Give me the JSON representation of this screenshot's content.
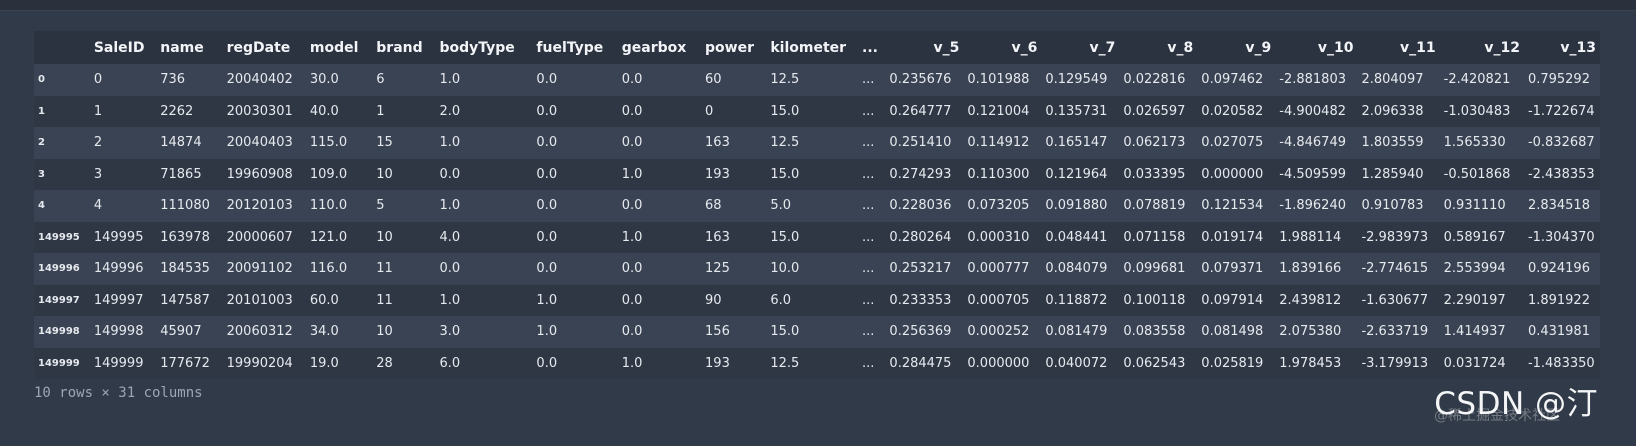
{
  "table": {
    "columns": [
      "",
      "SaleID",
      "name",
      "regDate",
      "model",
      "brand",
      "bodyType",
      "fuelType",
      "gearbox",
      "power",
      "kilometer",
      "...",
      "v_5",
      "v_6",
      "v_7",
      "v_8",
      "v_9",
      "v_10",
      "v_11",
      "v_12",
      "v_13"
    ],
    "rows": [
      [
        "0",
        "0",
        "736",
        "20040402",
        "30.0",
        "6",
        "1.0",
        "0.0",
        "0.0",
        "60",
        "12.5",
        "...",
        "0.235676",
        "0.101988",
        "0.129549",
        "0.022816",
        "0.097462",
        "-2.881803",
        "2.804097",
        "-2.420821",
        "0.795292"
      ],
      [
        "1",
        "1",
        "2262",
        "20030301",
        "40.0",
        "1",
        "2.0",
        "0.0",
        "0.0",
        "0",
        "15.0",
        "...",
        "0.264777",
        "0.121004",
        "0.135731",
        "0.026597",
        "0.020582",
        "-4.900482",
        "2.096338",
        "-1.030483",
        "-1.722674"
      ],
      [
        "2",
        "2",
        "14874",
        "20040403",
        "115.0",
        "15",
        "1.0",
        "0.0",
        "0.0",
        "163",
        "12.5",
        "...",
        "0.251410",
        "0.114912",
        "0.165147",
        "0.062173",
        "0.027075",
        "-4.846749",
        "1.803559",
        "1.565330",
        "-0.832687"
      ],
      [
        "3",
        "3",
        "71865",
        "19960908",
        "109.0",
        "10",
        "0.0",
        "0.0",
        "1.0",
        "193",
        "15.0",
        "...",
        "0.274293",
        "0.110300",
        "0.121964",
        "0.033395",
        "0.000000",
        "-4.509599",
        "1.285940",
        "-0.501868",
        "-2.438353"
      ],
      [
        "4",
        "4",
        "111080",
        "20120103",
        "110.0",
        "5",
        "1.0",
        "0.0",
        "0.0",
        "68",
        "5.0",
        "...",
        "0.228036",
        "0.073205",
        "0.091880",
        "0.078819",
        "0.121534",
        "-1.896240",
        "0.910783",
        "0.931110",
        "2.834518"
      ],
      [
        "149995",
        "149995",
        "163978",
        "20000607",
        "121.0",
        "10",
        "4.0",
        "0.0",
        "1.0",
        "163",
        "15.0",
        "...",
        "0.280264",
        "0.000310",
        "0.048441",
        "0.071158",
        "0.019174",
        "1.988114",
        "-2.983973",
        "0.589167",
        "-1.304370"
      ],
      [
        "149996",
        "149996",
        "184535",
        "20091102",
        "116.0",
        "11",
        "0.0",
        "0.0",
        "0.0",
        "125",
        "10.0",
        "...",
        "0.253217",
        "0.000777",
        "0.084079",
        "0.099681",
        "0.079371",
        "1.839166",
        "-2.774615",
        "2.553994",
        "0.924196"
      ],
      [
        "149997",
        "149997",
        "147587",
        "20101003",
        "60.0",
        "11",
        "1.0",
        "1.0",
        "0.0",
        "90",
        "6.0",
        "...",
        "0.233353",
        "0.000705",
        "0.118872",
        "0.100118",
        "0.097914",
        "2.439812",
        "-1.630677",
        "2.290197",
        "1.891922"
      ],
      [
        "149998",
        "149998",
        "45907",
        "20060312",
        "34.0",
        "10",
        "3.0",
        "1.0",
        "0.0",
        "156",
        "15.0",
        "...",
        "0.256369",
        "0.000252",
        "0.081479",
        "0.083558",
        "0.081498",
        "2.075380",
        "-2.633719",
        "1.414937",
        "0.431981"
      ],
      [
        "149999",
        "149999",
        "177672",
        "19990204",
        "19.0",
        "28",
        "6.0",
        "0.0",
        "1.0",
        "193",
        "12.5",
        "...",
        "0.284475",
        "0.000000",
        "0.040072",
        "0.062543",
        "0.025819",
        "1.978453",
        "-3.179913",
        "0.031724",
        "-1.483350"
      ]
    ]
  },
  "footer": {
    "summary": "10 rows × 31 columns"
  },
  "watermark": {
    "text": "CSDN @汀",
    "faint_text": "@稀土掘金技术社区"
  }
}
